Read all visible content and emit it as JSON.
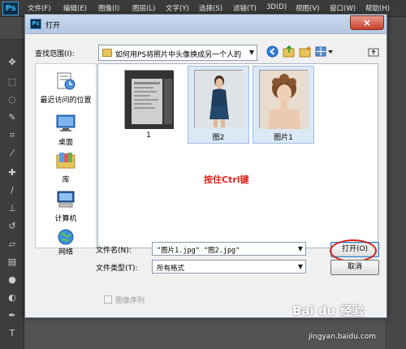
{
  "app": {
    "logo": "Ps"
  },
  "menubar": [
    "文件(F)",
    "编辑(E)",
    "图像(I)",
    "图层(L)",
    "文字(Y)",
    "选择(S)",
    "滤镜(T)",
    "3D(D)",
    "视图(V)",
    "窗口(W)",
    "帮助(H)"
  ],
  "dialog": {
    "title": "打开",
    "close_label": "×",
    "lookin_label": "查找范围(I):",
    "lookin_value": "如何用PS将照片中头像换成另一个人的",
    "nav_icons": [
      "back-icon",
      "up-folder-icon",
      "new-folder-icon",
      "view-menu-icon"
    ],
    "places": [
      {
        "label": "最近访问的位置",
        "icon": "recent-places-icon"
      },
      {
        "label": "桌面",
        "icon": "desktop-icon"
      },
      {
        "label": "库",
        "icon": "libraries-icon"
      },
      {
        "label": "计算机",
        "icon": "computer-icon"
      },
      {
        "label": "网络",
        "icon": "network-icon"
      }
    ],
    "files": [
      {
        "name": "1",
        "selected": false
      },
      {
        "name": "图2",
        "selected": true
      },
      {
        "name": "图片1",
        "selected": true
      }
    ],
    "annotation": "按住Ctrl键",
    "filename_label": "文件名(N):",
    "filename_value": "\"图片1.jpg\" \"图2.jpg\"",
    "filetype_label": "文件类型(T):",
    "filetype_value": "所有格式",
    "open_button": "打开(O)",
    "cancel_button": "取消",
    "image_sequence_label": "图像序列"
  },
  "watermark": {
    "main": "Bai du 经验",
    "sub": "jingyan.baidu.com"
  },
  "colors": {
    "annotation": "#e0231b",
    "selection": "#dbe8f6",
    "titlebar": "#c9d9ee"
  }
}
